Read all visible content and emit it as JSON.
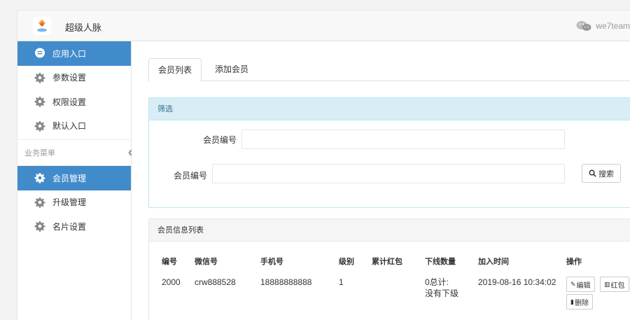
{
  "header": {
    "app_title": "超级人脉",
    "account": "we7team"
  },
  "sidebar": {
    "items": [
      {
        "label": "应用入口",
        "icon": "chat-bubble-icon",
        "active": true
      },
      {
        "label": "参数设置",
        "icon": "gear-icon"
      },
      {
        "label": "权限设置",
        "icon": "gear-icon"
      },
      {
        "label": "默认入口",
        "icon": "gear-icon"
      }
    ],
    "section_label": "业务菜单",
    "business_items": [
      {
        "label": "会员管理",
        "icon": "gear-icon",
        "active": true
      },
      {
        "label": "升级管理",
        "icon": "gear-icon"
      },
      {
        "label": "名片设置",
        "icon": "gear-icon"
      }
    ]
  },
  "tabs": [
    "会员列表",
    "添加会员"
  ],
  "filter": {
    "title": "筛选",
    "field1_label": "会员编号",
    "field2_label": "会员编号",
    "search_label": "搜索"
  },
  "member_list": {
    "title": "会员信息列表",
    "columns": [
      "编号",
      "微信号",
      "手机号",
      "级别",
      "累计红包",
      "下线数量",
      "加入时间",
      "操作"
    ],
    "rows": [
      {
        "id": "2000",
        "wechat": "crw888528",
        "phone": "18888888888",
        "level": "1",
        "red_packet": "",
        "downline_total": "0总计:",
        "downline_note": "没有下级",
        "joined": "2019-08-16 10:34:02",
        "ops": {
          "edit": "编辑",
          "red": "红包",
          "delete": "删除"
        }
      }
    ]
  },
  "colors": {
    "accent": "#428bca",
    "info_bg": "#d9edf7",
    "info_border": "#bce8f1",
    "info_text": "#31708f"
  }
}
